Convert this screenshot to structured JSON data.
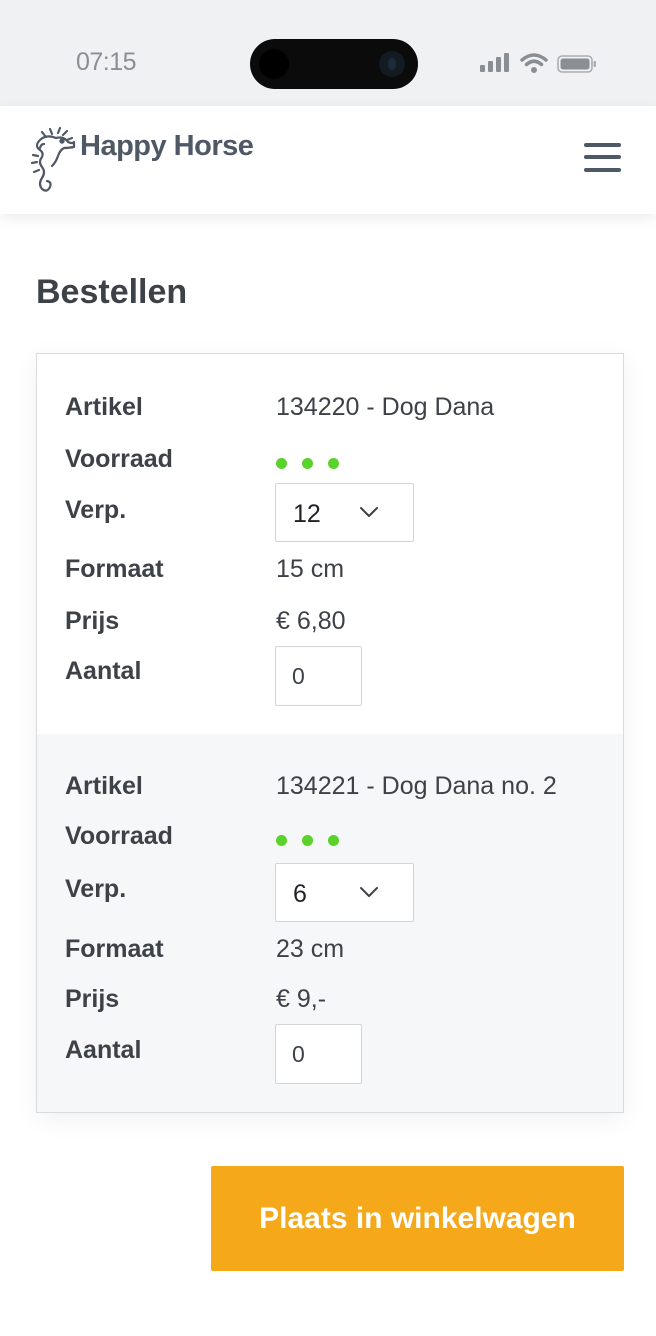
{
  "status_bar": {
    "time": "07:15"
  },
  "header": {
    "brand": "Happy Horse",
    "logo_icon": "seahorse-icon",
    "menu_icon": "hamburger-icon"
  },
  "page": {
    "title": "Bestellen"
  },
  "labels": {
    "article": "Artikel",
    "stock": "Voorraad",
    "packaging": "Verp.",
    "size": "Formaat",
    "price": "Prijs",
    "quantity": "Aantal"
  },
  "products": [
    {
      "article": "134220 - Dog Dana",
      "stock_color": "#5bd12c",
      "packaging": "12",
      "size": "15 cm",
      "price": "€ 6,80",
      "quantity": "0"
    },
    {
      "article": "134221 - Dog Dana no. 2",
      "stock_color": "#5bd12c",
      "packaging": "6",
      "size": "23 cm",
      "price": "€ 9,-",
      "quantity": "0"
    }
  ],
  "actions": {
    "add_to_cart": "Plaats in winkelwagen"
  },
  "colors": {
    "accent": "#f5a91a",
    "stock": "#5bd12c",
    "text": "#3d4148"
  }
}
